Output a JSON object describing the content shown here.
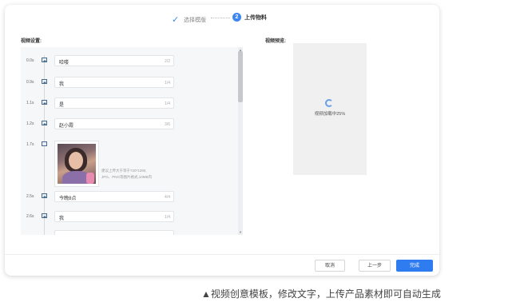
{
  "stepper": {
    "step1_label": "选择模版",
    "step2_number": "2",
    "step2_label": "上传物料"
  },
  "settings": {
    "label": "视频设置:",
    "rows": [
      {
        "time": "0.0s",
        "text": "哈喽",
        "count": "2/2"
      },
      {
        "time": "0.9s",
        "text": "我",
        "count": "1/4"
      },
      {
        "time": "1.1s",
        "text": "是",
        "count": "1/4"
      },
      {
        "time": "1.2s",
        "text": "赵小霞",
        "count": "3/6"
      }
    ],
    "media_row": {
      "time": "1.7s",
      "hint_line1": "建议上传大于等于720*1280,",
      "hint_line2": "JPG、PNG等图片格式,10MB内"
    },
    "rows2": [
      {
        "time": "2.5s",
        "text": "今晚8点",
        "count": "4/4"
      },
      {
        "time": "2.6s",
        "text": "我",
        "count": "1/4"
      }
    ]
  },
  "preview": {
    "label": "视频预览:",
    "status": "视频加载中25%"
  },
  "footer": {
    "cancel": "取消",
    "prev": "上一步",
    "done": "完成"
  },
  "caption": "▲视频创意模板，修改文字，上传产品素材即可自动生成",
  "colors": {
    "accent": "#2f7cf0",
    "spinner": "#6a9fe8"
  },
  "icons": {
    "step_done": "check-icon",
    "row": "image-icon",
    "loading": "spinner-icon"
  }
}
